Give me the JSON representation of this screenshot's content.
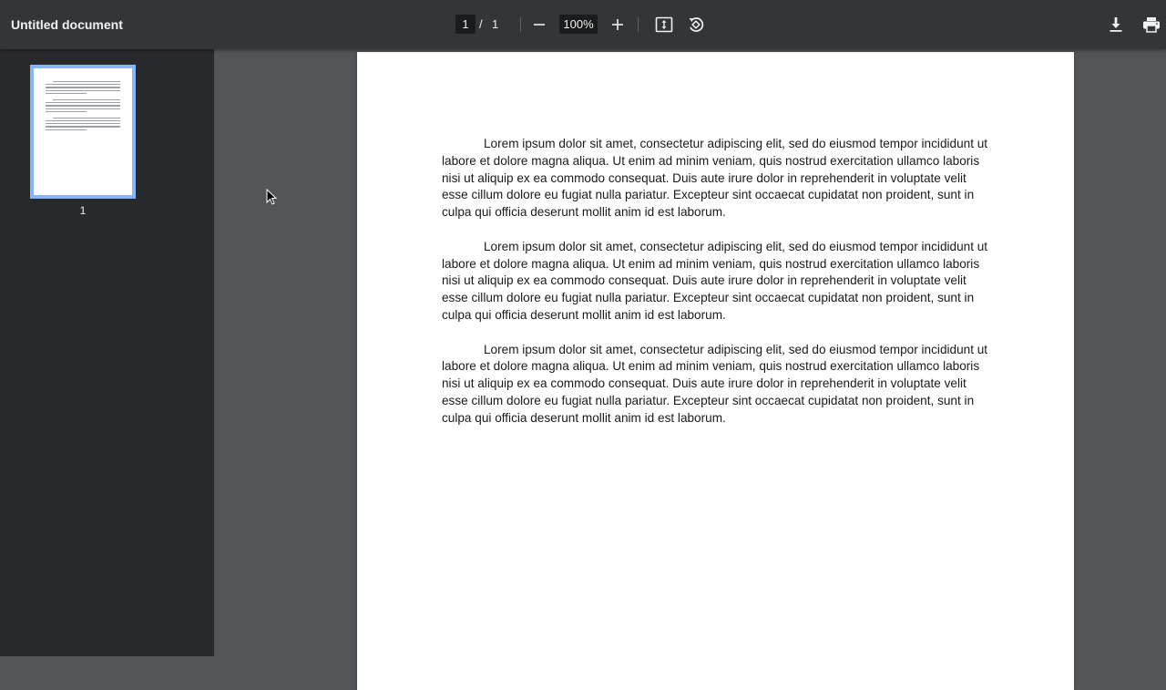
{
  "document": {
    "title": "Untitled document"
  },
  "toolbar": {
    "current_page": "1",
    "page_separator": "/",
    "total_pages": "1",
    "zoom": "100%",
    "buttons": {
      "zoom_out_icon": "minus-icon",
      "zoom_in_icon": "plus-icon",
      "fit_icon": "fit-page-icon",
      "rotate_icon": "rotate-counterclockwise-icon",
      "download_icon": "download-icon",
      "print_icon": "print-icon"
    }
  },
  "sidebar": {
    "thumbnails": [
      {
        "label": "1",
        "selected": true
      }
    ]
  },
  "page": {
    "paragraphs": [
      "Lorem ipsum dolor sit amet, consectetur adipiscing elit, sed do eiusmod tempor incididunt ut labore et dolore magna aliqua. Ut enim ad minim veniam, quis nostrud exercitation ullamco laboris nisi ut aliquip ex ea commodo consequat. Duis aute irure dolor in reprehenderit in voluptate velit esse cillum dolore eu fugiat nulla pariatur. Excepteur sint occaecat cupidatat non proident, sunt in culpa qui officia deserunt mollit anim id est laborum.",
      "Lorem ipsum dolor sit amet, consectetur adipiscing elit, sed do eiusmod tempor incididunt ut labore et dolore magna aliqua. Ut enim ad minim veniam, quis nostrud exercitation ullamco laboris nisi ut aliquip ex ea commodo consequat. Duis aute irure dolor in reprehenderit in voluptate velit esse cillum dolore eu fugiat nulla pariatur. Excepteur sint occaecat cupidatat non proident, sunt in culpa qui officia deserunt mollit anim id est laborum.",
      "Lorem ipsum dolor sit amet, consectetur adipiscing elit, sed do eiusmod tempor incididunt ut labore et dolore magna aliqua. Ut enim ad minim veniam, quis nostrud exercitation ullamco laboris nisi ut aliquip ex ea commodo consequat. Duis aute irure dolor in reprehenderit in voluptate velit esse cillum dolore eu fugiat nulla pariatur. Excepteur sint occaecat cupidatat non proident, sunt in culpa qui officia deserunt mollit anim id est laborum."
    ]
  },
  "colors": {
    "toolbar_bg": "#323639",
    "sidebar_bg": "#28292b",
    "viewer_bg": "#525659",
    "thumbnail_selected_border": "#8ab4f8",
    "text_on_dark": "#f1f1f1"
  }
}
